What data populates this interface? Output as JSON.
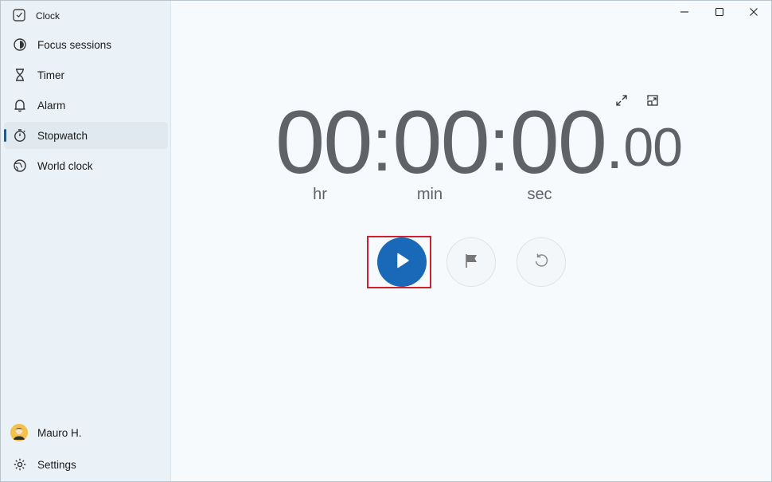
{
  "app": {
    "title": "Clock"
  },
  "sidebar": {
    "items": [
      {
        "label": "Focus sessions",
        "icon": "focus-icon"
      },
      {
        "label": "Timer",
        "icon": "hourglass-icon"
      },
      {
        "label": "Alarm",
        "icon": "bell-icon"
      },
      {
        "label": "Stopwatch",
        "icon": "stopwatch-icon",
        "selected": true
      },
      {
        "label": "World clock",
        "icon": "globe-icon"
      }
    ],
    "user": {
      "name": "Mauro H."
    },
    "settings": {
      "label": "Settings"
    }
  },
  "stopwatch": {
    "hours": "00",
    "minutes": "00",
    "seconds": "00",
    "hundredths": "00",
    "units": {
      "hr": "hr",
      "min": "min",
      "sec": "sec"
    }
  },
  "colors": {
    "accent": "#005fb8",
    "play": "#1a69b8",
    "highlight": "#d0202e"
  }
}
